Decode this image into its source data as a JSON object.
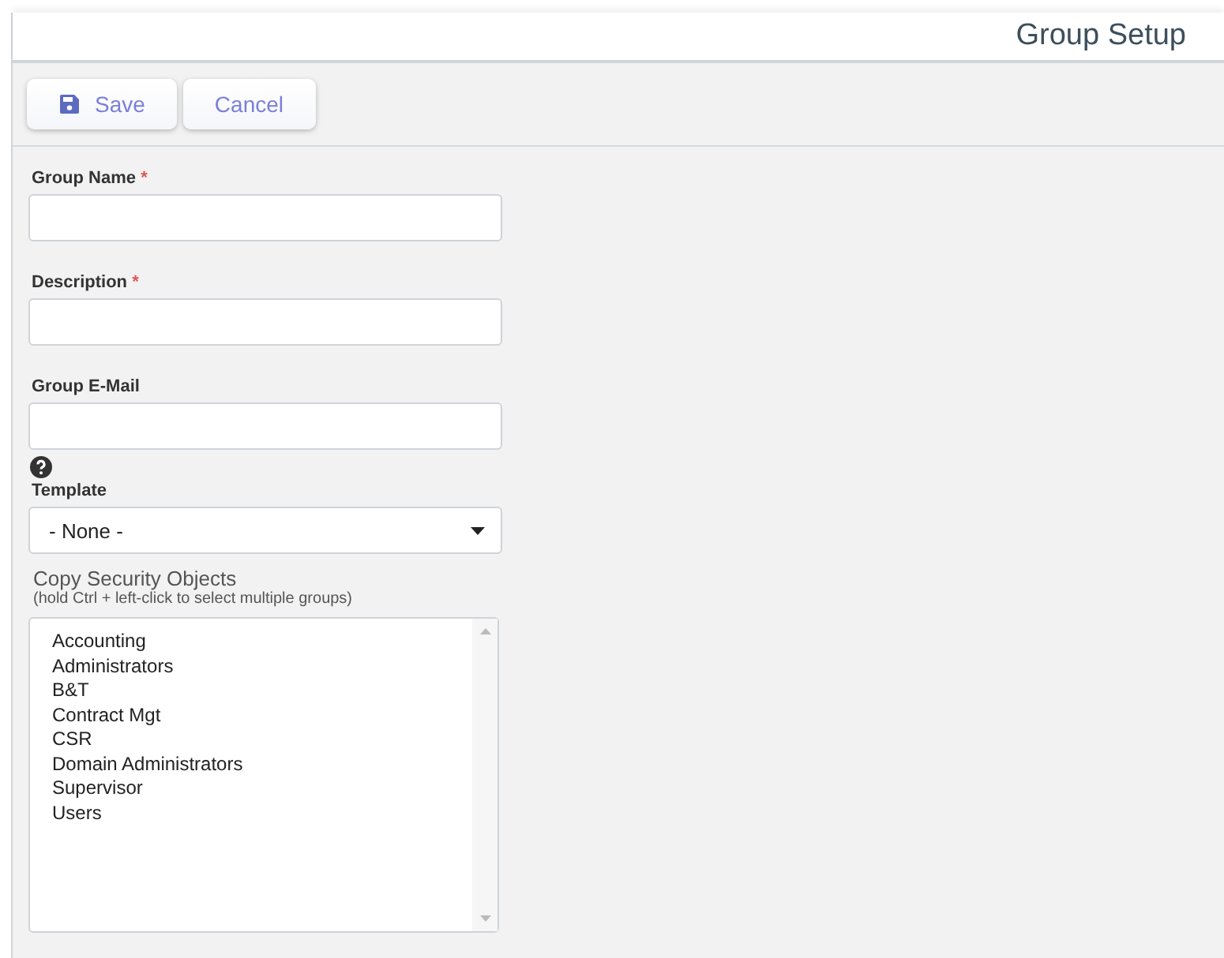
{
  "header": {
    "title": "Group Setup"
  },
  "toolbar": [
    {
      "label": "Save",
      "kind": "save"
    },
    {
      "label": "Cancel",
      "kind": "cancel"
    }
  ],
  "fields": [
    {
      "kind": "text",
      "label": "Group Name",
      "required_mark": "*"
    },
    {
      "kind": "text",
      "label": "Description",
      "required_mark": "*"
    },
    {
      "kind": "text",
      "label": "Group E-Mail"
    },
    {
      "kind": "help"
    },
    {
      "kind": "select",
      "label": "Template",
      "value": "- None -"
    }
  ],
  "copy_security": {
    "title": "Copy Security Objects",
    "hint": "(hold Ctrl + left-click to select multiple groups)",
    "items": [
      "Accounting",
      "Administrators",
      "B&T",
      "Contract Mgt",
      "CSR",
      "Domain Administrators",
      "Supervisor",
      "Users"
    ]
  }
}
